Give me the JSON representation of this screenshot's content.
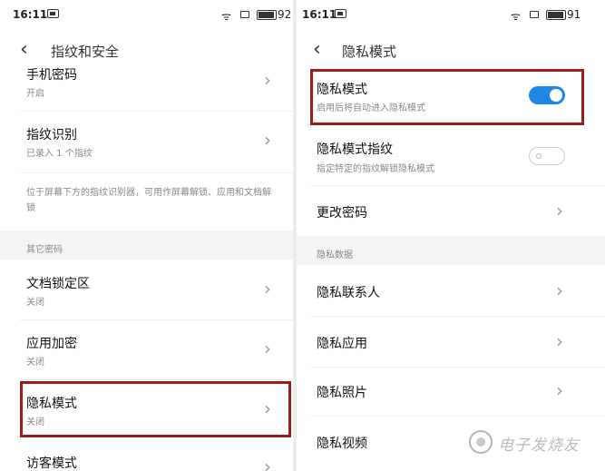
{
  "left": {
    "status": {
      "time": "16:11",
      "battery": "92"
    },
    "header": {
      "back": "‹",
      "title": "指纹和安全"
    },
    "items": [
      {
        "title": "手机密码",
        "sub": "开启"
      },
      {
        "title": "指纹识别",
        "sub": "已录入 1 个指纹"
      },
      {
        "title": "文档锁定区",
        "sub": "关闭"
      },
      {
        "title": "应用加密",
        "sub": "关闭"
      },
      {
        "title": "隐私模式",
        "sub": "关闭"
      },
      {
        "title": "访客模式",
        "sub": ""
      }
    ],
    "note": "位于屏幕下方的指纹识别器，可用作屏幕解锁、应用和文档解锁",
    "section": "其它密码"
  },
  "right": {
    "status": {
      "time": "16:11",
      "battery": "91"
    },
    "header": {
      "back": "‹",
      "title": "隐私模式"
    },
    "privacy_mode": {
      "title": "隐私模式",
      "sub": "启用后将自动进入隐私模式",
      "on": true
    },
    "privacy_fingerprint": {
      "title": "隐私模式指纹",
      "sub": "指定特定的指纹解锁隐私模式",
      "on": false
    },
    "change_password": {
      "title": "更改密码"
    },
    "section": "隐私数据",
    "data_items": [
      {
        "title": "隐私联系人"
      },
      {
        "title": "隐私应用"
      },
      {
        "title": "隐私照片"
      },
      {
        "title": "隐私视频"
      }
    ]
  },
  "chevron": "›",
  "wifi": "ᯤ",
  "watermark": "电子发烧友",
  "colors": {
    "highlight": "#9c1b1b",
    "toggle_on": "#1f86e8"
  }
}
